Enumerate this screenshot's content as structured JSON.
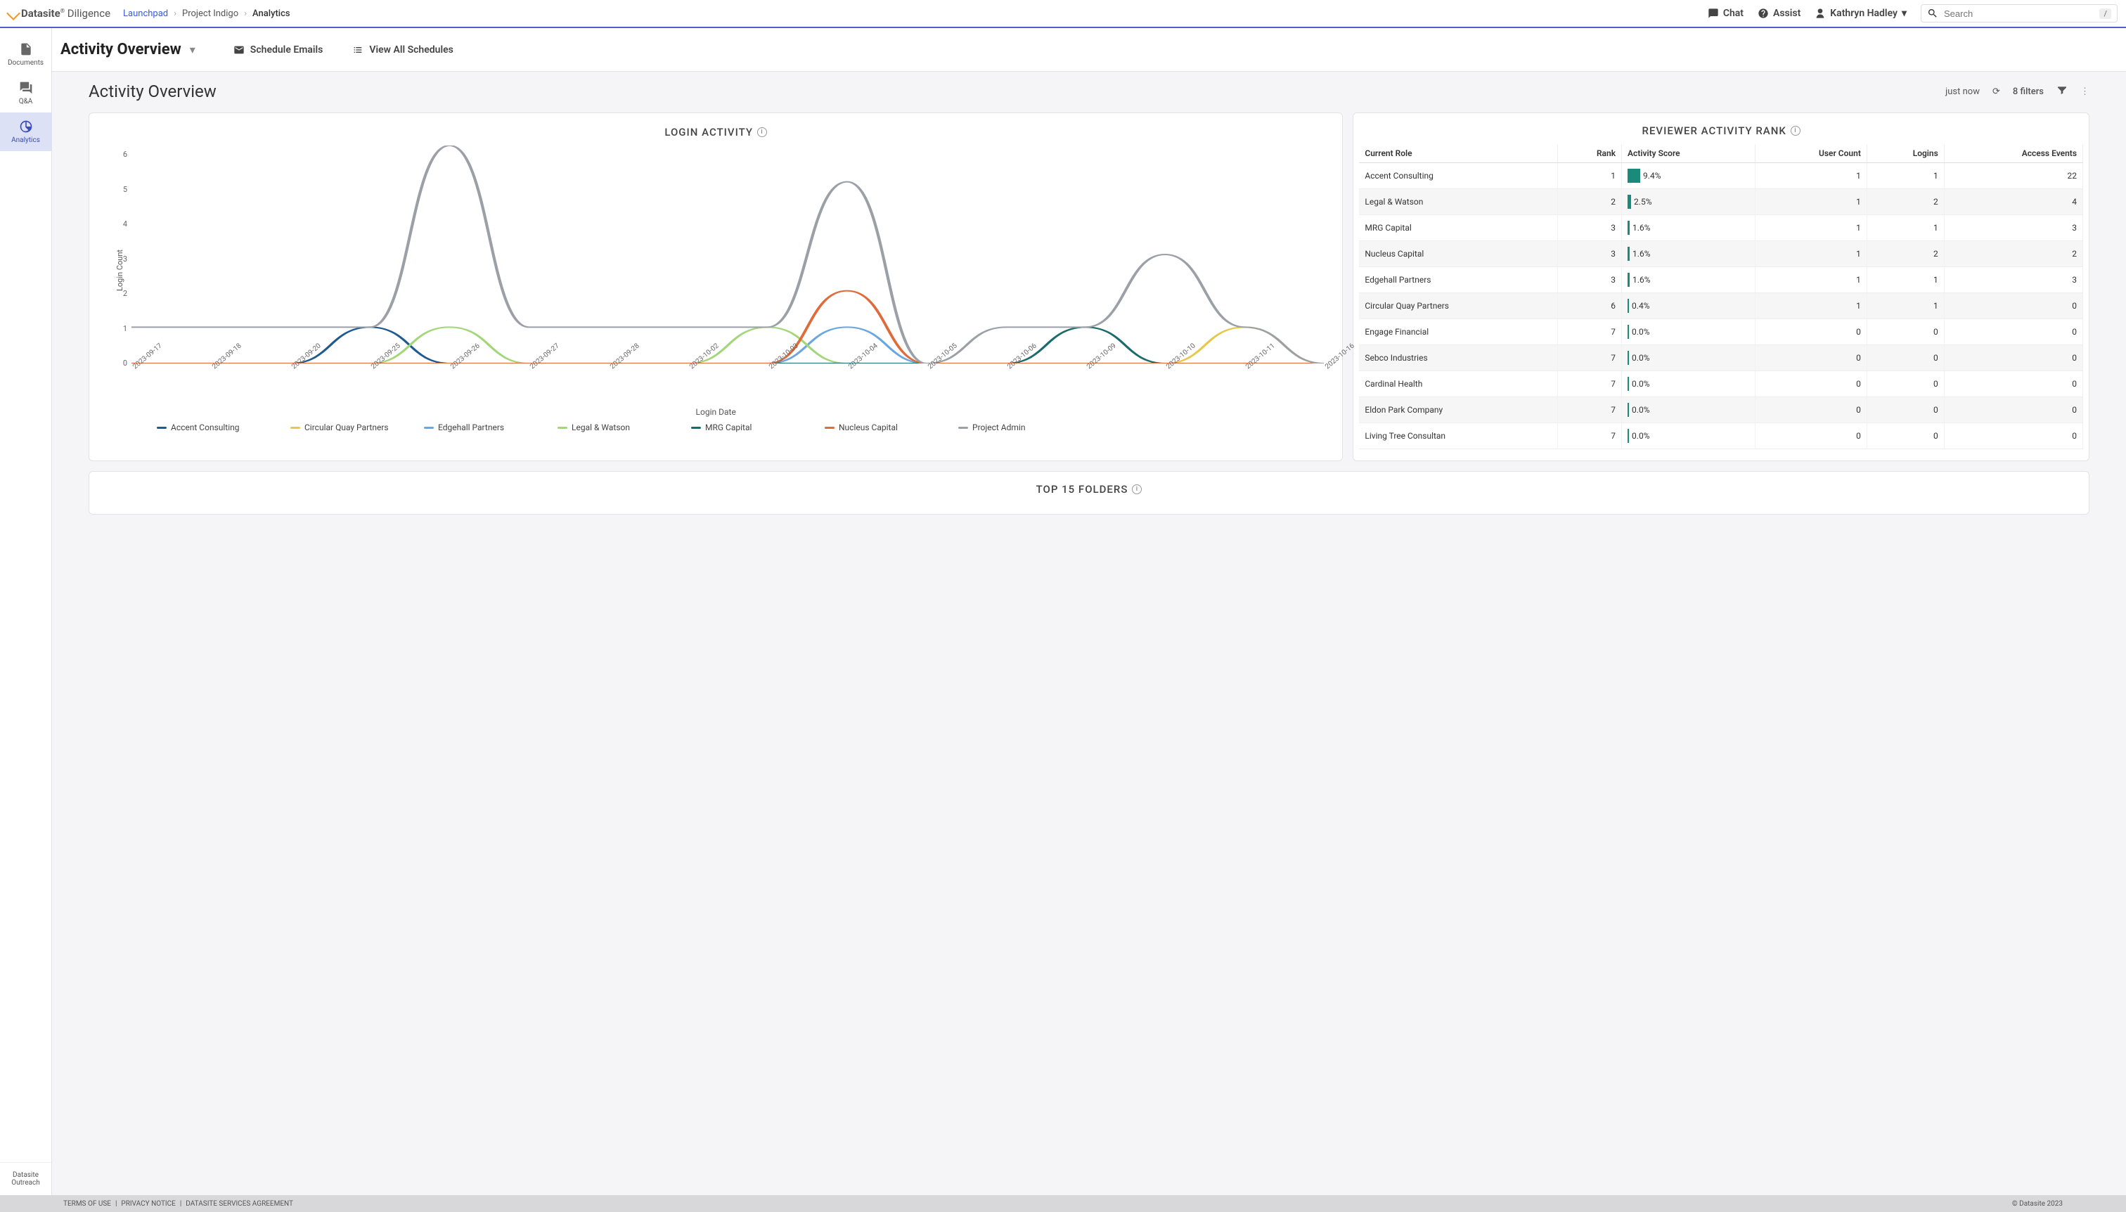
{
  "brand": {
    "name_bold": "Datasite",
    "name_light": "Diligence"
  },
  "breadcrumb": {
    "items": [
      "Launchpad",
      "Project Indigo",
      "Analytics"
    ]
  },
  "topbar": {
    "chat": "Chat",
    "assist": "Assist",
    "user": "Kathryn Hadley",
    "search_placeholder": "Search",
    "shortcut": "/"
  },
  "sidebar": {
    "items": [
      {
        "key": "documents",
        "label": "Documents"
      },
      {
        "key": "qa",
        "label": "Q&A"
      },
      {
        "key": "analytics",
        "label": "Analytics"
      }
    ],
    "bottom": "Datasite Outreach"
  },
  "page": {
    "title": "Activity Overview",
    "action_schedule": "Schedule Emails",
    "action_view": "View All Schedules"
  },
  "subhead": {
    "title": "Activity Overview",
    "time": "just now",
    "filters": "8 filters"
  },
  "login_chart": {
    "title": "LOGIN ACTIVITY",
    "xlabel": "Login Date",
    "ylabel": "Login Count",
    "legend": [
      {
        "name": "Accent Consulting",
        "color": "#1e5a8f"
      },
      {
        "name": "Circular Quay Partners",
        "color": "#e6c94a"
      },
      {
        "name": "Edgehall Partners",
        "color": "#6aa7e0"
      },
      {
        "name": "Legal & Watson",
        "color": "#a2d67a"
      },
      {
        "name": "MRG Capital",
        "color": "#1a6b6b"
      },
      {
        "name": "Nucleus Capital",
        "color": "#e06b3a"
      },
      {
        "name": "Project Admin",
        "color": "#9aa0a6"
      }
    ]
  },
  "chart_data": {
    "type": "line",
    "title": "LOGIN ACTIVITY",
    "xlabel": "Login Date",
    "ylabel": "Login Count",
    "ylim": [
      0,
      6
    ],
    "categories": [
      "2023-09-17",
      "2023-09-18",
      "2023-09-20",
      "2023-09-25",
      "2023-09-26",
      "2023-09-27",
      "2023-09-28",
      "2023-10-02",
      "2023-10-03",
      "2023-10-04",
      "2023-10-05",
      "2023-10-06",
      "2023-10-09",
      "2023-10-10",
      "2023-10-11",
      "2023-10-16"
    ],
    "series": [
      {
        "name": "Accent Consulting",
        "color": "#1e5a8f",
        "values": [
          0,
          0,
          0,
          1,
          0,
          0,
          0,
          0,
          0,
          0,
          0,
          0,
          0,
          0,
          0,
          0
        ]
      },
      {
        "name": "Circular Quay Partners",
        "color": "#e6c94a",
        "values": [
          0,
          0,
          0,
          0,
          0,
          0,
          0,
          0,
          0,
          0,
          0,
          0,
          0,
          0,
          1,
          0
        ]
      },
      {
        "name": "Edgehall Partners",
        "color": "#6aa7e0",
        "values": [
          0,
          0,
          0,
          0,
          0,
          0,
          0,
          0,
          0,
          1,
          0,
          0,
          0,
          0,
          0,
          0
        ]
      },
      {
        "name": "Legal & Watson",
        "color": "#a2d67a",
        "values": [
          0,
          0,
          0,
          0,
          1,
          0,
          0,
          0,
          1,
          0,
          0,
          0,
          0,
          0,
          0,
          0
        ]
      },
      {
        "name": "MRG Capital",
        "color": "#1a6b6b",
        "values": [
          0,
          0,
          0,
          0,
          0,
          0,
          0,
          0,
          0,
          0,
          0,
          0,
          1,
          0,
          0,
          0
        ]
      },
      {
        "name": "Nucleus Capital",
        "color": "#e06b3a",
        "values": [
          0,
          0,
          0,
          0,
          0,
          0,
          0,
          0,
          0,
          2,
          0,
          0,
          0,
          0,
          0,
          0
        ]
      },
      {
        "name": "Project Admin",
        "color": "#9aa0a6",
        "values": [
          1,
          1,
          1,
          1,
          6,
          1,
          1,
          1,
          1,
          5,
          0,
          1,
          1,
          3,
          1,
          0
        ]
      }
    ]
  },
  "rank_table": {
    "title": "REVIEWER ACTIVITY RANK",
    "columns": [
      "Current Role",
      "Rank",
      "Activity Score",
      "User Count",
      "Logins",
      "Access Events"
    ],
    "rows": [
      {
        "role": "Accent Consulting",
        "rank": 1,
        "score": "9.4%",
        "bar": 18,
        "users": 1,
        "logins": 1,
        "events": 22
      },
      {
        "role": "Legal & Watson",
        "rank": 2,
        "score": "2.5%",
        "bar": 5,
        "users": 1,
        "logins": 2,
        "events": 4
      },
      {
        "role": "MRG Capital",
        "rank": 3,
        "score": "1.6%",
        "bar": 3,
        "users": 1,
        "logins": 1,
        "events": 3
      },
      {
        "role": "Nucleus Capital",
        "rank": 3,
        "score": "1.6%",
        "bar": 3,
        "users": 1,
        "logins": 2,
        "events": 2
      },
      {
        "role": "Edgehall Partners",
        "rank": 3,
        "score": "1.6%",
        "bar": 3,
        "users": 1,
        "logins": 1,
        "events": 3
      },
      {
        "role": "Circular Quay Partners",
        "rank": 6,
        "score": "0.4%",
        "bar": 2,
        "users": 1,
        "logins": 1,
        "events": 0
      },
      {
        "role": "Engage Financial",
        "rank": 7,
        "score": "0.0%",
        "bar": 2,
        "users": 0,
        "logins": 0,
        "events": 0
      },
      {
        "role": "Sebco Industries",
        "rank": 7,
        "score": "0.0%",
        "bar": 2,
        "users": 0,
        "logins": 0,
        "events": 0
      },
      {
        "role": "Cardinal Health",
        "rank": 7,
        "score": "0.0%",
        "bar": 2,
        "users": 0,
        "logins": 0,
        "events": 0
      },
      {
        "role": "Eldon Park Company",
        "rank": 7,
        "score": "0.0%",
        "bar": 2,
        "users": 0,
        "logins": 0,
        "events": 0
      },
      {
        "role": "Living Tree Consultan",
        "rank": 7,
        "score": "0.0%",
        "bar": 2,
        "users": 0,
        "logins": 0,
        "events": 0
      }
    ]
  },
  "folders": {
    "title": "TOP 15 FOLDERS"
  },
  "footer": {
    "terms": "TERMS OF USE",
    "privacy": "PRIVACY NOTICE",
    "agreement": "DATASITE SERVICES AGREEMENT",
    "copy": "© Datasite 2023"
  }
}
